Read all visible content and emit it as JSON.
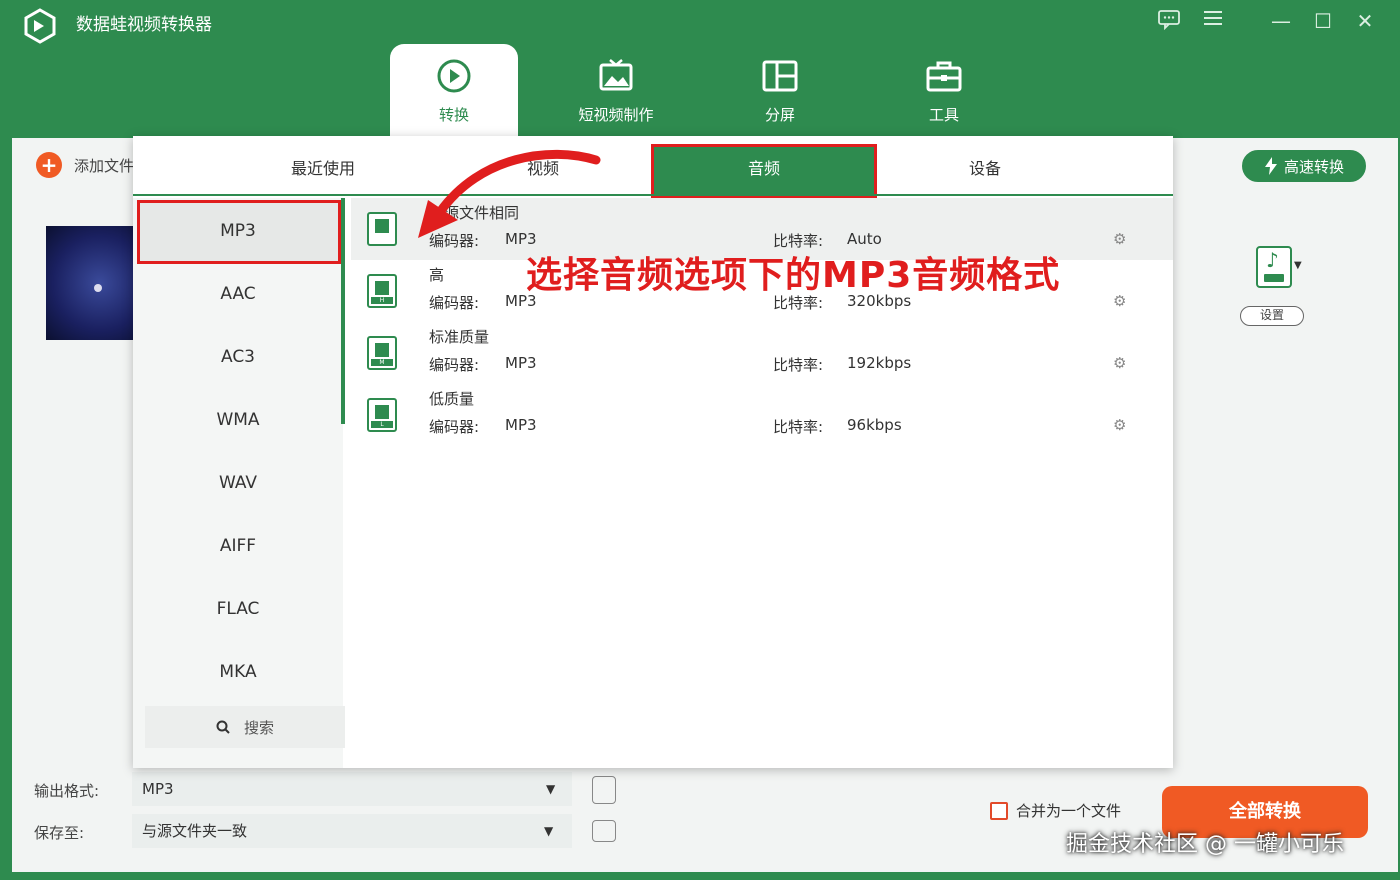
{
  "app": {
    "title": "数据蛙视频转换器"
  },
  "window_controls": {
    "feedback_icon": "chat-icon",
    "menu_icon": "hamburger-icon",
    "minimize": "—",
    "maximize": "☐",
    "close": "✕"
  },
  "nav": {
    "items": [
      {
        "label": "转换",
        "icon": "convert-icon",
        "active": true
      },
      {
        "label": "短视频制作",
        "icon": "short-video-icon",
        "active": false
      },
      {
        "label": "分屏",
        "icon": "split-screen-icon",
        "active": false
      },
      {
        "label": "工具",
        "icon": "toolbox-icon",
        "active": false
      }
    ]
  },
  "toolbar": {
    "add_file_label": "添加文件",
    "fast_convert_label": "高速转换",
    "settings_label": "设置"
  },
  "popup": {
    "tabs": [
      {
        "label": "最近使用",
        "active": false
      },
      {
        "label": "视频",
        "active": false
      },
      {
        "label": "音频",
        "active": true
      },
      {
        "label": "设备",
        "active": false
      }
    ],
    "formats": [
      "MP3",
      "AAC",
      "AC3",
      "WMA",
      "WAV",
      "AIFF",
      "FLAC",
      "MKA"
    ],
    "selected_format": "MP3",
    "search_label": "搜索",
    "presets": [
      {
        "name": "与源文件相同",
        "encoder_label": "编码器:",
        "encoder": "MP3",
        "bitrate_label": "比特率:",
        "bitrate": "Auto",
        "badge": ""
      },
      {
        "name": "高",
        "encoder_label": "编码器:",
        "encoder": "MP3",
        "bitrate_label": "比特率:",
        "bitrate": "320kbps",
        "badge": "H"
      },
      {
        "name": "标准质量",
        "encoder_label": "编码器:",
        "encoder": "MP3",
        "bitrate_label": "比特率:",
        "bitrate": "192kbps",
        "badge": "M"
      },
      {
        "name": "低质量",
        "encoder_label": "编码器:",
        "encoder": "MP3",
        "bitrate_label": "比特率:",
        "bitrate": "96kbps",
        "badge": "L"
      }
    ]
  },
  "annotation": {
    "callout_text": "选择音频选项下的MP3音频格式"
  },
  "bottom": {
    "output_format_label": "输出格式:",
    "output_format_value": "MP3",
    "save_to_label": "保存至:",
    "save_to_value": "与源文件夹一致",
    "merge_label": "合并为一个文件",
    "convert_all_label": "全部转换"
  },
  "watermark": "掘金技术社区 @ 一罐小可乐",
  "colors": {
    "brand_green": "#2e8b4f",
    "accent_orange": "#f05a24",
    "annotation_red": "#e01e1e"
  }
}
